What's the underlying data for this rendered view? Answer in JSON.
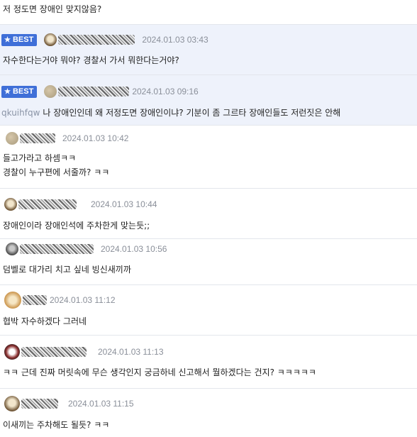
{
  "comments": [
    {
      "best": false,
      "nickname_masked": true,
      "date": "",
      "lines": [
        "저 정도면 장애인 맞지않음?"
      ]
    },
    {
      "best": true,
      "badge": "BEST",
      "date": "2024.01.03 03:43",
      "lines": [
        "자수한다는거야 뭐야? 경찰서 가서 뭐한다는거야?"
      ]
    },
    {
      "best": true,
      "badge": "BEST",
      "date": "2024.01.03 09:16",
      "quote": "qkuihfqw",
      "lines": [
        "나 장애인인데 왜 저정도면 장애인이냐? 기분이 좀 그르타 장애인들도 저런짓은 안해"
      ]
    },
    {
      "best": false,
      "date": "2024.01.03 10:42",
      "lines": [
        "들고가라고 하셈ㅋㅋ",
        "경찰이 누구편에 서줄까? ㅋㅋ"
      ]
    },
    {
      "best": false,
      "date": "2024.01.03 10:44",
      "lines": [
        "장애인이라 장애인석에 주차한게 맞는듯;;"
      ]
    },
    {
      "best": false,
      "date": "2024.01.03 10:56",
      "lines": [
        "덤벨로 대가리 치고 싶네 빙신새끼까"
      ]
    },
    {
      "best": false,
      "date": "2024.01.03 11:12",
      "lines": [
        "협박 자수하겠다 그러네"
      ]
    },
    {
      "best": false,
      "date": "2024.01.03 11:13",
      "lines": [
        "ㅋㅋ 근데 진짜 머릿속에 무슨 생각인지 궁금하네 신고해서 뭘하겠다는 건지? ㅋㅋㅋㅋㅋ"
      ]
    },
    {
      "best": false,
      "date": "2024.01.03 11:15",
      "lines": [
        "이새끼는 주차해도 될듯? ㅋㅋ"
      ]
    }
  ],
  "icons": {
    "best_star": "star-icon"
  },
  "colors": {
    "best_badge": "#3f6fd8",
    "best_row": "#eef2fb",
    "date": "#8a8f99"
  }
}
